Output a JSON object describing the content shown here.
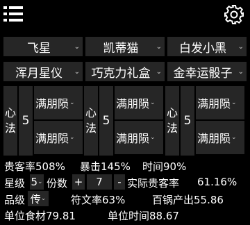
{
  "header": {
    "menu_icon": "menu-icon",
    "gear_icon": "gear-icon"
  },
  "characters": [
    {
      "name": "飞星"
    },
    {
      "name": "凯蒂猫"
    },
    {
      "name": "白发小黑"
    },
    {
      "name": "浑月星仪"
    },
    {
      "name": "巧克力礼盒"
    },
    {
      "name": "金幸运骰子"
    }
  ],
  "xinfa_label_1": "心",
  "xinfa_label_2": "法",
  "columns": [
    {
      "level": "5",
      "slot1": "满朋陨",
      "slot2": "满朋陨"
    },
    {
      "level": "5",
      "slot1": "满朋陨",
      "slot2": "满朋陨"
    },
    {
      "level": "5",
      "slot1": "满朋陨",
      "slot2": "满朋陨"
    }
  ],
  "stats": {
    "guest_rate": "贵客率508%",
    "crit": "暴击145%",
    "time": "时间90%",
    "star_label": "星级",
    "star_value": "5",
    "count_label": "份数",
    "count_plus": "+",
    "count_value": "7",
    "count_minus": "-",
    "actual_guest_label": "实际贵客率",
    "actual_guest_value": "61.16%",
    "grade_label": "品级",
    "grade_value": "传",
    "fuwen_rate": "符文率63%",
    "pot_output": "百锅产出55.86",
    "unit_food": "单位食材79.81",
    "unit_time": "单位时间88.67"
  }
}
